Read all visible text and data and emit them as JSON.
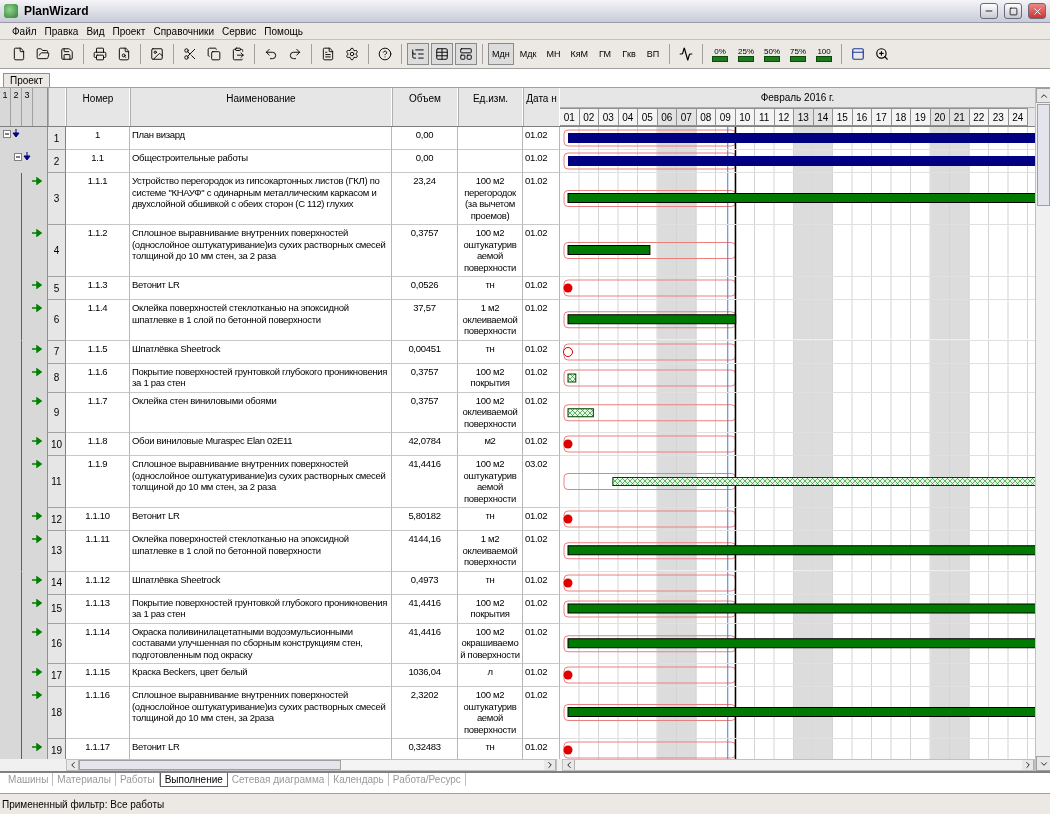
{
  "window": {
    "title": "PlanWizard"
  },
  "menu": [
    "Файл",
    "Правка",
    "Вид",
    "Проект",
    "Справочники",
    "Сервис",
    "Помощь"
  ],
  "toolbar": {
    "view_buttons": [
      {
        "label": "Мдн",
        "selected": true
      },
      {
        "label": "Мдк",
        "selected": false
      },
      {
        "label": "МН",
        "selected": false
      },
      {
        "label": "КяМ",
        "selected": false
      },
      {
        "label": "ГМ",
        "selected": false
      },
      {
        "label": "Гкв",
        "selected": false
      },
      {
        "label": "ВП",
        "selected": false
      }
    ],
    "progress_buttons": [
      "0%",
      "25%",
      "50%",
      "75%",
      "100"
    ]
  },
  "document_tab": "Проект",
  "outline_levels": [
    "1",
    "2",
    "3"
  ],
  "columns": [
    "Номер",
    "Наименование",
    "Объем",
    "Ед.изм.",
    "Дата н"
  ],
  "gantt": {
    "month": "Февраль 2016 г.",
    "days": [
      {
        "label": "01",
        "weekend": false
      },
      {
        "label": "02",
        "weekend": false
      },
      {
        "label": "03",
        "weekend": false
      },
      {
        "label": "04",
        "weekend": false
      },
      {
        "label": "05",
        "weekend": false
      },
      {
        "label": "06",
        "weekend": true
      },
      {
        "label": "07",
        "weekend": true
      },
      {
        "label": "08",
        "weekend": false
      },
      {
        "label": "09",
        "weekend": false
      },
      {
        "label": "10",
        "weekend": false
      },
      {
        "label": "11",
        "weekend": false
      },
      {
        "label": "12",
        "weekend": false
      },
      {
        "label": "13",
        "weekend": true
      },
      {
        "label": "14",
        "weekend": true
      },
      {
        "label": "15",
        "weekend": false
      },
      {
        "label": "16",
        "weekend": false
      },
      {
        "label": "17",
        "weekend": false
      },
      {
        "label": "18",
        "weekend": false
      },
      {
        "label": "19",
        "weekend": false
      },
      {
        "label": "20",
        "weekend": true
      },
      {
        "label": "21",
        "weekend": true
      },
      {
        "label": "22",
        "weekend": false
      },
      {
        "label": "23",
        "weekend": false
      },
      {
        "label": "24",
        "weekend": false
      }
    ]
  },
  "rows": [
    {
      "row": "1",
      "number": "1",
      "name": "План визард",
      "volume": "0,00",
      "date": "01.02",
      "kind": "summary",
      "children": [
        {
          "row": "2",
          "number": "1.1",
          "name": "Общестроительные работы",
          "volume": "0,00",
          "date": "01.02",
          "kind": "summary",
          "children": [
            {
              "row": "3",
              "number": "1.1.1",
              "name": "Устройство перегородок из гипсокартонных листов (ГКЛ) по системе \"КНАУФ\" с одинарным металлическим каркасом и двухслойной обшивкой с обеих сторон (С 112) глухих",
              "volume": "23,24",
              "unit": "100 м2 перегородок (за вычетом проемов)",
              "date": "01.02",
              "kind": "task"
            },
            {
              "row": "4",
              "number": "1.1.2",
              "name": "Сплошное выравнивание внутренних поверхностей (однослойное оштукатуривание)из сухих растворных смесей толщиной до 10 мм стен, за 2 раза",
              "volume": "0,3757",
              "unit": "100 м2 оштукатурив аемой поверхности",
              "date": "01.02",
              "kind": "task"
            },
            {
              "row": "5",
              "number": "1.1.3",
              "name": "Ветонит LR",
              "volume": "0,0526",
              "unit": "тн",
              "date": "01.02",
              "kind": "milestone"
            },
            {
              "row": "6",
              "number": "1.1.4",
              "name": "Оклейка поверхностей стеклотканью на эпоксидной шпатлевке в 1 слой по бетонной поверхности",
              "volume": "37,57",
              "unit": "1 м2 оклеиваемой поверхности",
              "date": "01.02",
              "kind": "task"
            },
            {
              "row": "7",
              "number": "1.1.5",
              "name": "Шпатлёвка Sheetrock",
              "volume": "0,00451",
              "unit": "тн",
              "date": "01.02",
              "kind": "milestone-open"
            },
            {
              "row": "8",
              "number": "1.1.6",
              "name": "Покрытие поверхностей грунтовкой глубокого проникновения за 1 раз стен",
              "volume": "0,3757",
              "unit": "100 м2 покрытия",
              "date": "01.02",
              "kind": "hatched"
            },
            {
              "row": "9",
              "number": "1.1.7",
              "name": "Оклейка стен виниловыми обоями",
              "volume": "0,3757",
              "unit": "100 м2 оклеиваемой поверхности",
              "date": "01.02",
              "kind": "hatched"
            },
            {
              "row": "10",
              "number": "1.1.8",
              "name": "Обои виниловые Muraspec Elan 02E11",
              "volume": "42,0784",
              "unit": "м2",
              "date": "01.02",
              "kind": "milestone"
            },
            {
              "row": "11",
              "number": "1.1.9",
              "name": "Сплошное выравнивание внутренних поверхностей (однослойное оштукатуривание)из сухих растворных смесей толщиной до 10 мм стен, за 2 раза",
              "volume": "41,4416",
              "unit": "100 м2 оштукатурив аемой поверхности",
              "date": "03.02",
              "kind": "hatched"
            },
            {
              "row": "12",
              "number": "1.1.10",
              "name": "Ветонит LR",
              "volume": "5,80182",
              "unit": "тн",
              "date": "01.02",
              "kind": "milestone"
            },
            {
              "row": "13",
              "number": "1.1.11",
              "name": "Оклейка поверхностей стеклотканью на эпоксидной шпатлевке в 1 слой по бетонной поверхности",
              "volume": "4144,16",
              "unit": "1 м2 оклеиваемой поверхности",
              "date": "01.02",
              "kind": "task"
            },
            {
              "row": "14",
              "number": "1.1.12",
              "name": "Шпатлёвка Sheetrock",
              "volume": "0,4973",
              "unit": "тн",
              "date": "01.02",
              "kind": "milestone"
            },
            {
              "row": "15",
              "number": "1.1.13",
              "name": "Покрытие поверхностей грунтовкой глубокого проникновения за 1 раз стен",
              "volume": "41,4416",
              "unit": "100 м2 покрытия",
              "date": "01.02",
              "kind": "task"
            },
            {
              "row": "16",
              "number": "1.1.14",
              "name": "Окраска поливинилацетатными водоэмульсионными составами улучшенная по сборным конструкциям стен, подготовленным под окраску",
              "volume": "41,4416",
              "unit": "100 м2 окрашиваемо й поверхности",
              "date": "01.02",
              "kind": "task"
            },
            {
              "row": "17",
              "number": "1.1.15",
              "name": "Краска Beckers, цвет белый",
              "volume": "1036,04",
              "unit": "л",
              "date": "01.02",
              "kind": "milestone"
            },
            {
              "row": "18",
              "number": "1.1.16",
              "name": "Сплошное выравнивание внутренних поверхностей (однослойное оштукатуривание)из сухих растворных смесей толщиной до 10 мм стен, за 2раза",
              "volume": "2,3202",
              "unit": "100 м2 оштукатурив аемой поверхности",
              "date": "01.02",
              "kind": "task"
            },
            {
              "row": "19",
              "number": "1.1.17",
              "name": "Ветонит LR",
              "volume": "0,32483",
              "unit": "тн",
              "date": "01.02",
              "kind": "milestone"
            }
          ]
        }
      ]
    }
  ],
  "bottom_tabs": [
    {
      "label": "Машины",
      "selected": false
    },
    {
      "label": "Материалы",
      "selected": false
    },
    {
      "label": "Работы",
      "selected": false
    },
    {
      "label": "Выполнение",
      "selected": true
    },
    {
      "label": "Сетевая диаграмма",
      "selected": false
    },
    {
      "label": "Календарь",
      "selected": false
    },
    {
      "label": "Работа/Ресурс",
      "selected": false
    }
  ],
  "status_bar": "Примененный фильтр: Все работы"
}
